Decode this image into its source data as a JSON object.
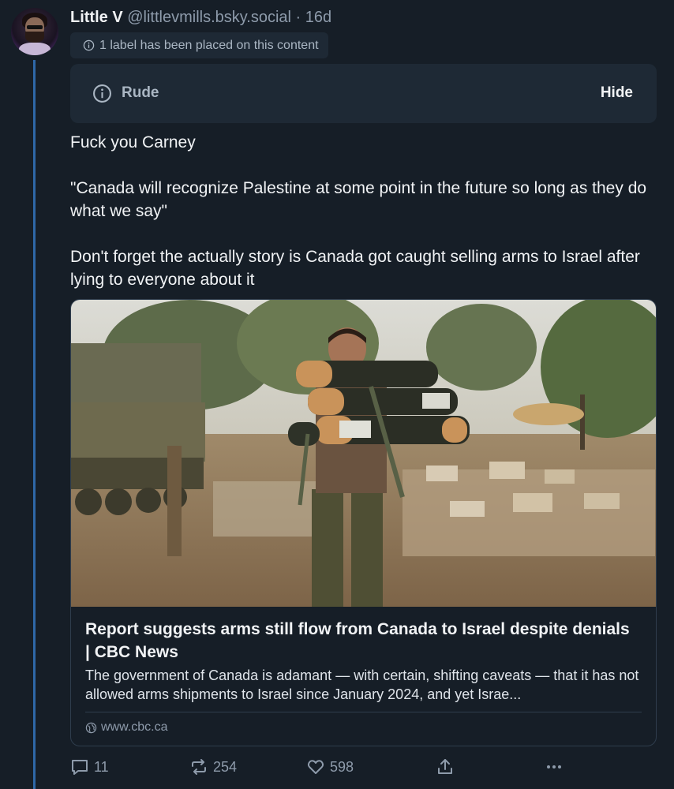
{
  "author": {
    "name": "Little V",
    "handle": "@littlevmills.bsky.social",
    "separator": "·",
    "age": "16d"
  },
  "label_notice": "1 label has been placed on this content",
  "content_warning": {
    "label": "Rude",
    "hide_label": "Hide"
  },
  "post_text": [
    "Fuck you Carney",
    "\"Canada will recognize Palestine at some point in the future so long as they do what we say\"",
    "Don't forget the actually story is Canada got caught selling arms to Israel after lying to everyone about it"
  ],
  "link_card": {
    "title": "Report suggests arms still flow from Canada to Israel despite denials | CBC News",
    "description": "The government of Canada is adamant — with certain, shifting caveats — that it has not allowed arms shipments to Israel since January 2024, and yet Israe...",
    "domain": "www.cbc.ca"
  },
  "actions": {
    "replies": "11",
    "reposts": "254",
    "likes": "598"
  },
  "colors": {
    "background": "#161e27",
    "thread_line": "#2f68a8",
    "muted_text": "#8e9bab",
    "panel": "#1e2935"
  },
  "icons": [
    "info-icon",
    "globe-icon",
    "reply-icon",
    "repost-icon",
    "heart-icon",
    "share-icon",
    "more-icon"
  ]
}
